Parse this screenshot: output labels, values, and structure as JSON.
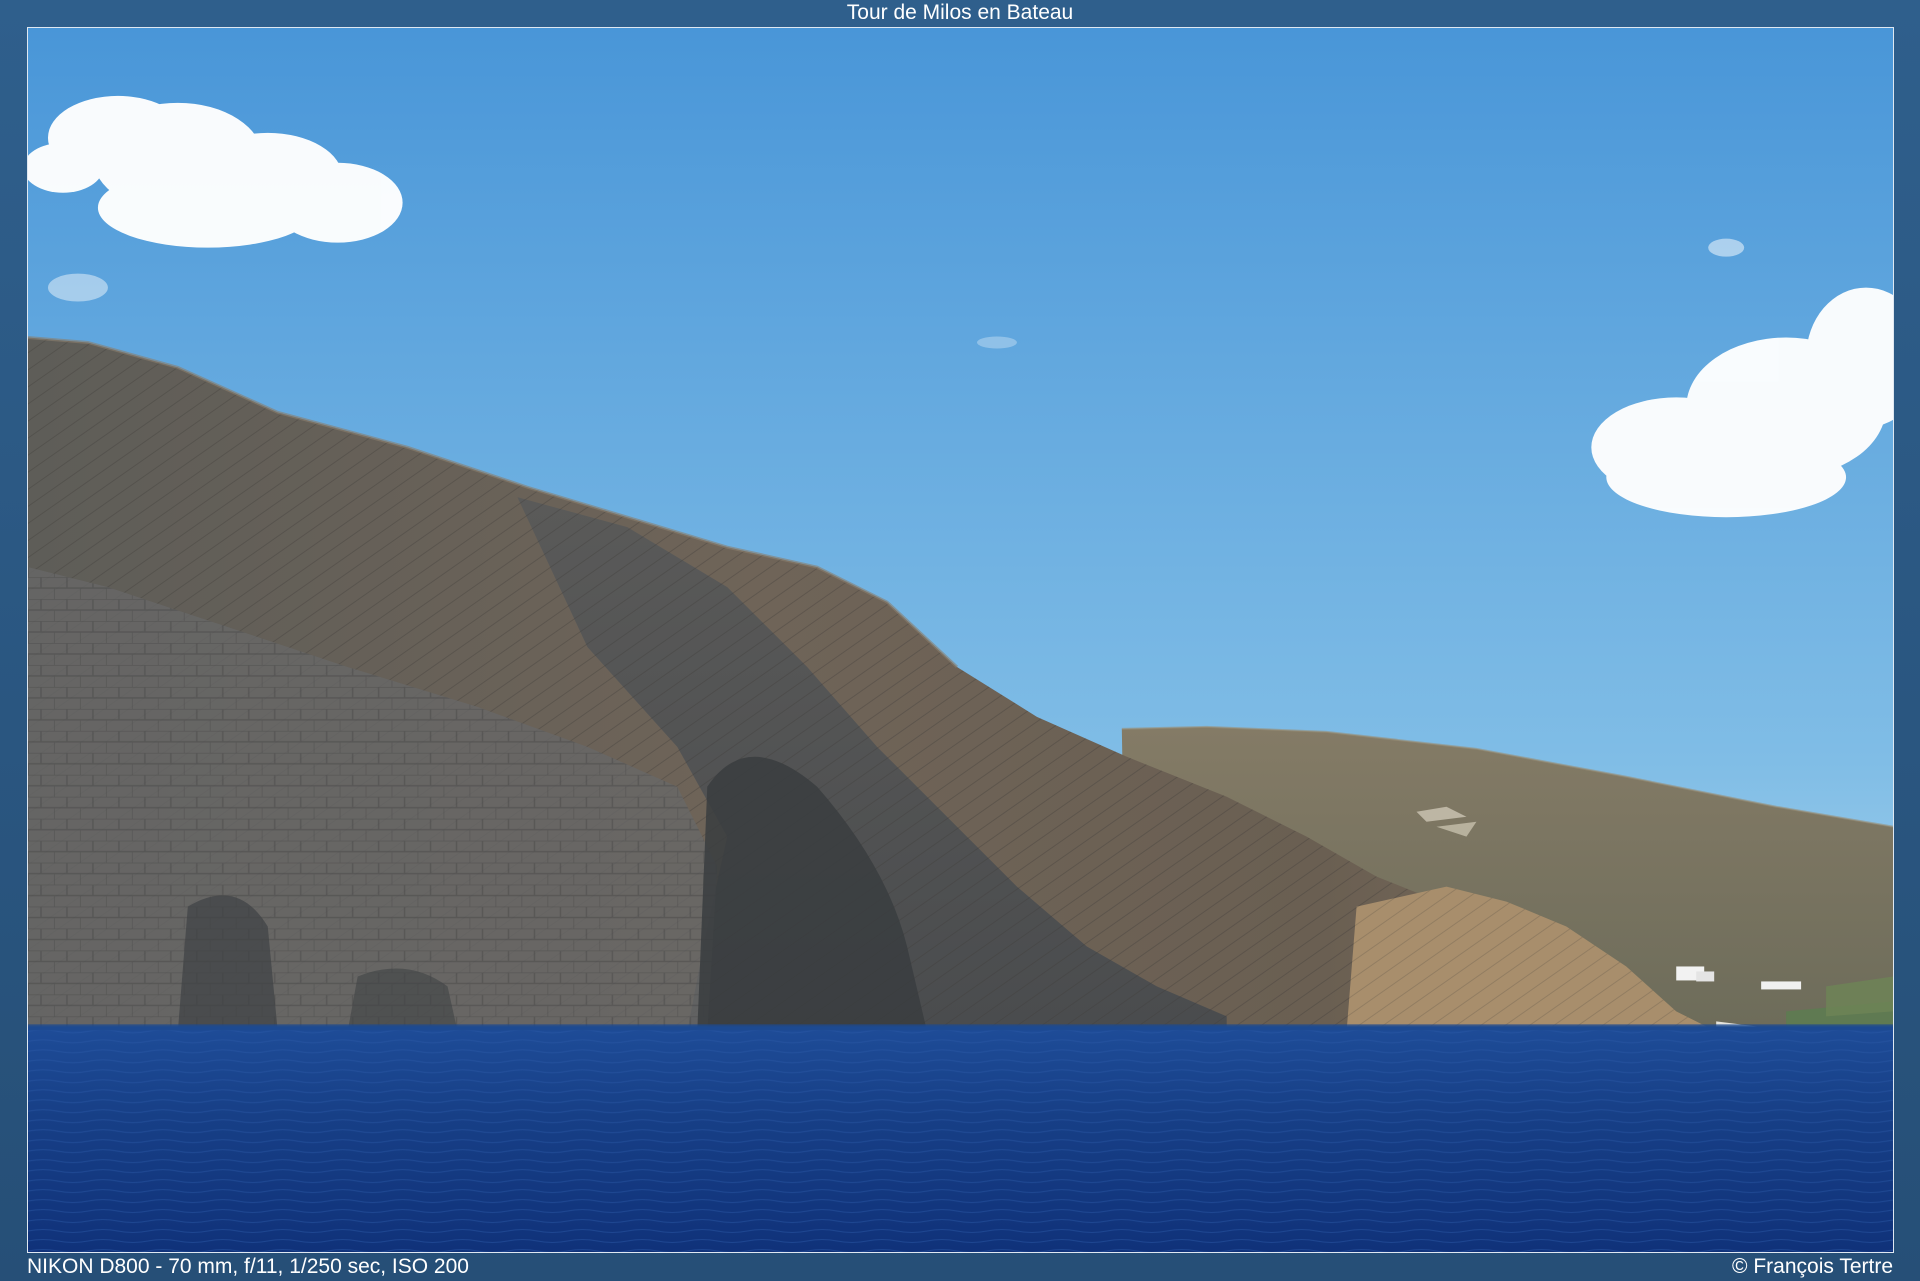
{
  "viewer": {
    "title": "Tour de Milos en Bateau",
    "exif": "NIKON D800 - 70 mm, f/11, 1/250 sec, ISO 200",
    "copyright": "© François Tertre"
  },
  "photo": {
    "sky_top": "#4996d8",
    "sky_bottom": "#8cc3e6",
    "sea_color": "#173f86",
    "cliff_color": "#6c6357",
    "hill_color": "#7c7564"
  }
}
